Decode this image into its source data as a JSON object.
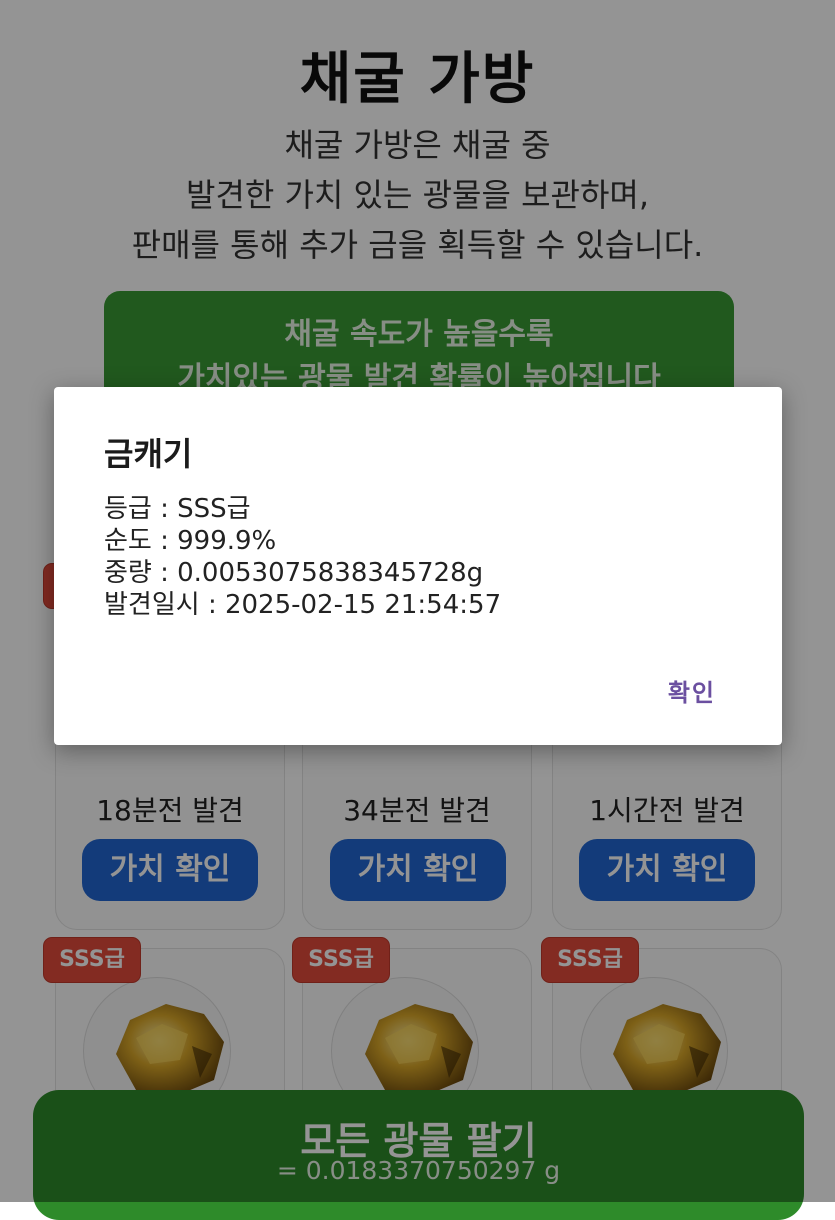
{
  "page": {
    "title": "채굴 가방",
    "description": [
      "채굴 가방은 채굴 중",
      "발견한 가치 있는 광물을 보관하며,",
      "판매를 통해 추가 금을 획득할 수 있습니다."
    ],
    "banner": [
      "채굴 속도가 높을수록",
      "가치있는 광물 발견 확률이 높아집니다"
    ]
  },
  "items_row1": [
    {
      "found": "18분전 발견",
      "button": "가치 확인"
    },
    {
      "found": "34분전 발견",
      "button": "가치 확인"
    },
    {
      "found": "1시간전 발견",
      "button": "가치 확인"
    }
  ],
  "items_row2": [
    {
      "grade": "SSS급"
    },
    {
      "grade": "SSS급"
    },
    {
      "grade": "SSS급"
    }
  ],
  "sell_all": {
    "label": "모든 광물 팔기",
    "amount": "= 0.0183370750297 g"
  },
  "dialog": {
    "title": "금캐기",
    "grade_line": "등급 : SSS급",
    "purity_line": "순도 : 999.9%",
    "weight_line": "중량 : 0.0053075838345728g",
    "found_line": "발견일시 : 2025-02-15 21:54:57",
    "ok_label": "확인"
  },
  "colors": {
    "banner_green": "#3a9a35",
    "sell_green": "#2e8b2a",
    "button_blue": "#2166d3",
    "grade_red": "#e24b3b",
    "dialog_accent": "#6b4fa0"
  },
  "icons": {
    "item_image": "gold-nugget-icon"
  }
}
